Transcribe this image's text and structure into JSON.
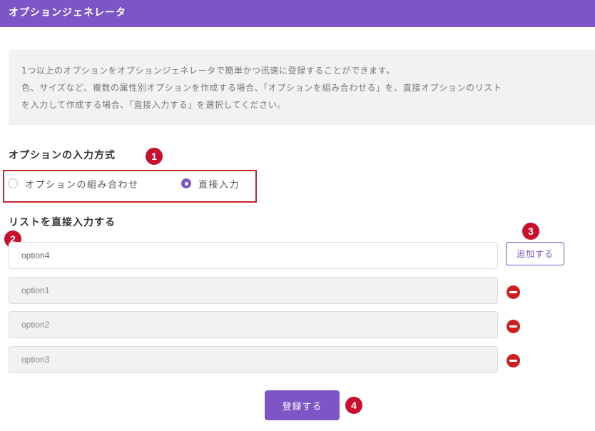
{
  "header": {
    "title": "オプションジェネレータ"
  },
  "info": {
    "lines": [
      "1つ以上のオプションをオプションジェネレータで簡単かつ迅速に登録することができます。",
      "色、サイズなど、複数の属性別オプションを作成する場合、「オプションを組み合わせる」を、直接オプションのリスト",
      "を入力して作成する場合、「直接入力する」を選択してください。"
    ]
  },
  "input_method": {
    "title": "オプションの入力方式",
    "options": [
      {
        "label": "オプションの組み合わせ",
        "selected": false
      },
      {
        "label": "直接入力",
        "selected": true
      }
    ]
  },
  "direct_list": {
    "title": "リストを直接入力する",
    "new_option_value": "option4",
    "add_label": "追加する",
    "options": [
      "option1",
      "option2",
      "option3"
    ]
  },
  "submit": {
    "label": "登録する"
  },
  "badges": [
    "1",
    "2",
    "3",
    "4"
  ],
  "colors": {
    "accent": "#7d55c7",
    "badge": "#c8102e",
    "remove": "#cc1f1f"
  }
}
